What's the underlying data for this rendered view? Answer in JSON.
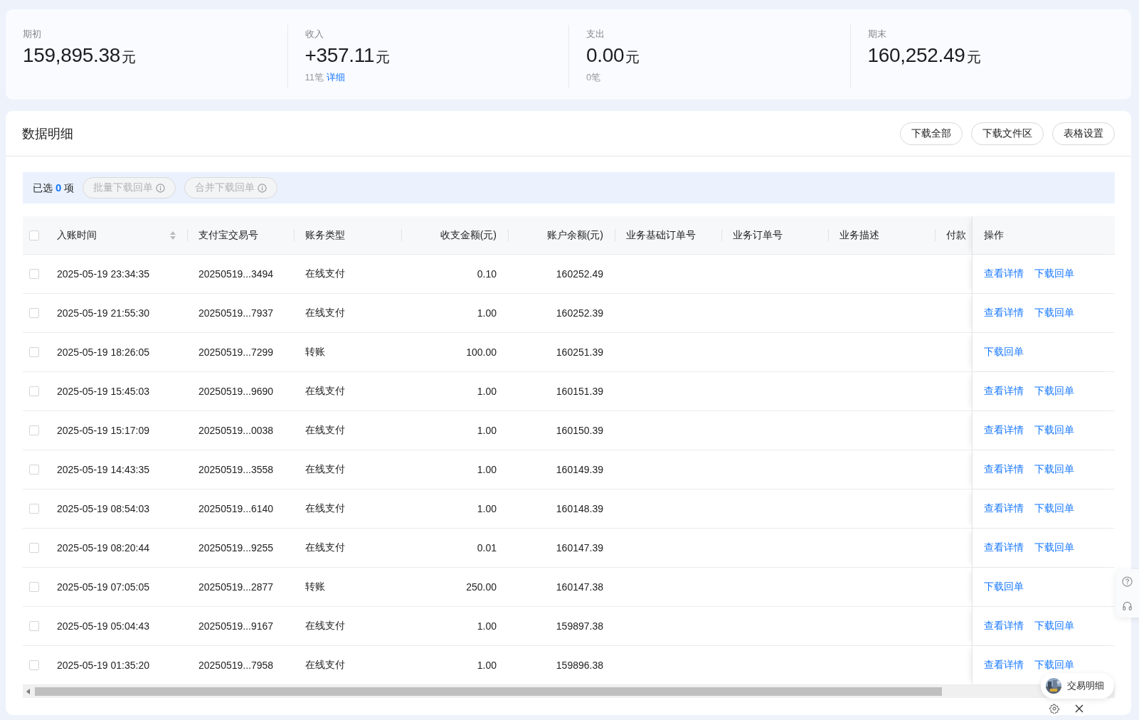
{
  "summary": [
    {
      "label": "期初",
      "value": "159,895.38",
      "unit": "元"
    },
    {
      "label": "收入",
      "value": "+357.11",
      "unit": "元",
      "count": "11笔",
      "link": "详细"
    },
    {
      "label": "支出",
      "value": "0.00",
      "unit": "元",
      "count": "0笔"
    },
    {
      "label": "期末",
      "value": "160,252.49",
      "unit": "元"
    }
  ],
  "panel": {
    "title": "数据明细",
    "buttons": [
      "下载全部",
      "下载文件区",
      "表格设置"
    ],
    "selection": {
      "text": "已选 **0** 项",
      "actions": [
        {
          "label": "批量下载回单",
          "disabled": true
        },
        {
          "label": "合并下载回单",
          "disabled": true
        }
      ]
    },
    "table": {
      "select_all": {
        "checked": false
      },
      "columns": [
        {
          "label": "入账时间",
          "sortable": true
        },
        {
          "label": "支付宝交易号"
        },
        {
          "label": "账务类型"
        },
        {
          "label": "收支金额(元)",
          "numeric": true
        },
        {
          "label": "账户余额(元)",
          "numeric": true
        },
        {
          "label": "业务基础订单号"
        },
        {
          "label": "业务订单号"
        },
        {
          "label": "业务描述"
        },
        {
          "label": "付款"
        },
        {
          "label": "操作"
        }
      ],
      "rows": [
        {
          "checked": false,
          "cells": [
            "2025-05-19 23:34:35",
            "20250519...3494",
            "在线支付",
            "0.10",
            "160252.49"
          ],
          "actions": [
            "查看详情",
            "下载回单"
          ]
        },
        {
          "checked": false,
          "cells": [
            "2025-05-19 21:55:30",
            "20250519...7937",
            "在线支付",
            "1.00",
            "160252.39"
          ],
          "actions": [
            "查看详情",
            "下载回单"
          ]
        },
        {
          "checked": false,
          "cells": [
            "2025-05-19 18:26:05",
            "20250519...7299",
            "转账",
            "100.00",
            "160251.39"
          ],
          "actions": [
            "下载回单"
          ]
        },
        {
          "checked": false,
          "cells": [
            "2025-05-19 15:45:03",
            "20250519...9690",
            "在线支付",
            "1.00",
            "160151.39"
          ],
          "actions": [
            "查看详情",
            "下载回单"
          ]
        },
        {
          "checked": false,
          "cells": [
            "2025-05-19 15:17:09",
            "20250519...0038",
            "在线支付",
            "1.00",
            "160150.39"
          ],
          "actions": [
            "查看详情",
            "下载回单"
          ]
        },
        {
          "checked": false,
          "cells": [
            "2025-05-19 14:43:35",
            "20250519...3558",
            "在线支付",
            "1.00",
            "160149.39"
          ],
          "actions": [
            "查看详情",
            "下载回单"
          ]
        },
        {
          "checked": false,
          "cells": [
            "2025-05-19 08:54:03",
            "20250519...6140",
            "在线支付",
            "1.00",
            "160148.39"
          ],
          "actions": [
            "查看详情",
            "下载回单"
          ]
        },
        {
          "checked": false,
          "cells": [
            "2025-05-19 08:20:44",
            "20250519...9255",
            "在线支付",
            "0.01",
            "160147.39"
          ],
          "actions": [
            "查看详情",
            "下载回单"
          ]
        },
        {
          "checked": false,
          "cells": [
            "2025-05-19 07:05:05",
            "20250519...2877",
            "转账",
            "250.00",
            "160147.38"
          ],
          "actions": [
            "下载回单"
          ]
        },
        {
          "checked": false,
          "cells": [
            "2025-05-19 05:04:43",
            "20250519...9167",
            "在线支付",
            "1.00",
            "159897.38"
          ],
          "actions": [
            "查看详情",
            "下载回单"
          ]
        },
        {
          "checked": false,
          "cells": [
            "2025-05-19 01:35:20",
            "20250519...7958",
            "在线支付",
            "1.00",
            "159896.38"
          ],
          "actions": [
            "查看详情",
            "下载回单"
          ]
        }
      ]
    }
  },
  "assistant": {
    "label": "交易明细"
  }
}
